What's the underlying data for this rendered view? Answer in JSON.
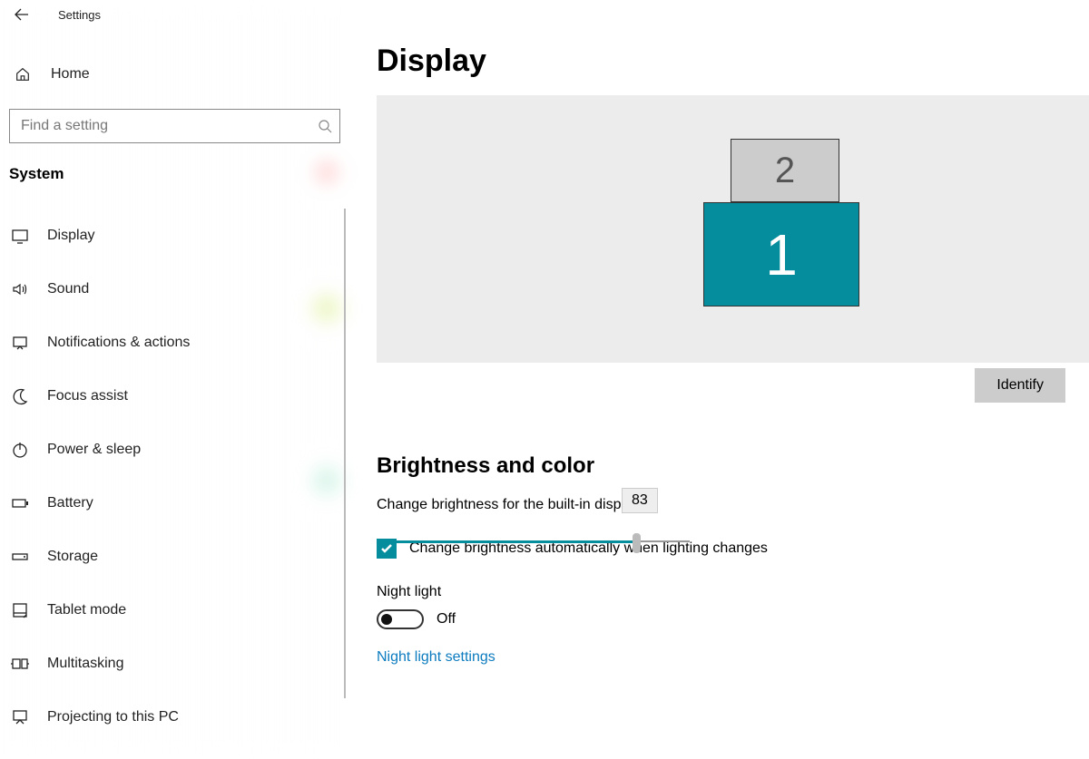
{
  "window": {
    "title": "Settings"
  },
  "sidebar": {
    "home_label": "Home",
    "search_placeholder": "Find a setting",
    "section_title": "System",
    "items": [
      {
        "label": "Display"
      },
      {
        "label": "Sound"
      },
      {
        "label": "Notifications & actions"
      },
      {
        "label": "Focus assist"
      },
      {
        "label": "Power & sleep"
      },
      {
        "label": "Battery"
      },
      {
        "label": "Storage"
      },
      {
        "label": "Tablet mode"
      },
      {
        "label": "Multitasking"
      },
      {
        "label": "Projecting to this PC"
      }
    ]
  },
  "display": {
    "page_title": "Display",
    "monitor1_label": "1",
    "monitor2_label": "2",
    "identify_label": "Identify",
    "brightness_section": "Brightness and color",
    "brightness_label": "Change brightness for the built-in display",
    "brightness_value": "83",
    "auto_brightness_label": "Change brightness automatically when lighting changes",
    "night_light_label": "Night light",
    "night_light_state": "Off",
    "night_light_link": "Night light settings"
  }
}
